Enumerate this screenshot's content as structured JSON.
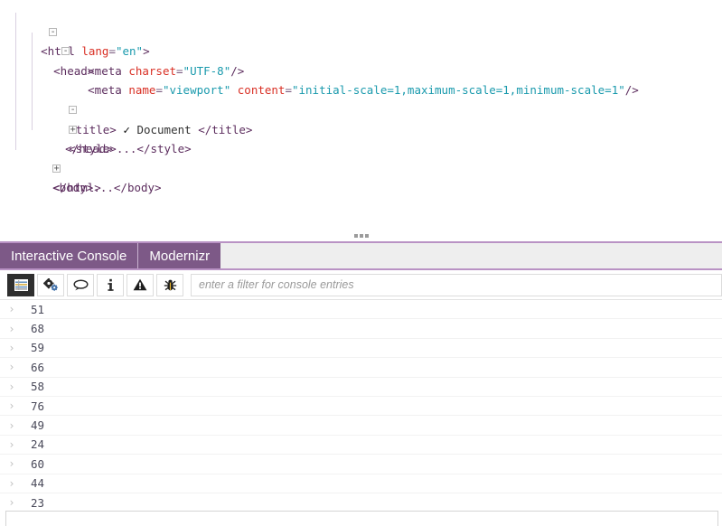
{
  "dom_inspector": {
    "lines": [
      {
        "toggle": "-",
        "indent": 0,
        "text": "<html lang=\"en\">"
      },
      {
        "toggle": "-",
        "indent": 1,
        "text": "<head>"
      },
      {
        "toggle": "",
        "indent": 2,
        "text": "<meta charset=\"UTF-8\"/>"
      },
      {
        "toggle": "",
        "indent": 2,
        "text": "<meta name=\"viewport\" content=\"initial-scale=1,maximum-scale=1,minimum-scale=1\"/>"
      },
      {
        "toggle": "-",
        "indent": 2,
        "text": "<title> ✓ Document </title>"
      },
      {
        "toggle": "+",
        "indent": 2,
        "text": "<style>...</style>"
      },
      {
        "toggle": "",
        "indent": 1,
        "text": "</head>"
      },
      {
        "toggle": "+",
        "indent": 1,
        "text": "<body>...</body>"
      },
      {
        "toggle": "",
        "indent": 0,
        "text": "</html>"
      }
    ],
    "tokens": {
      "html_tag_open": "<html",
      "html_attr": "lang",
      "html_attr_value": "\"en\"",
      "head_tag": "<head>",
      "meta_tag": "<meta",
      "charset_attr": "charset",
      "charset_value": "\"UTF-8\"",
      "self_close": "/>",
      "name_attr": "name",
      "name_value": "\"viewport\"",
      "content_attr": "content",
      "content_value": "\"initial-scale=1,maximum-scale=1,minimum-scale=1\"",
      "title_open": "<title>",
      "title_check": "✓",
      "title_text": "Document",
      "title_close": "</title>",
      "style_open": "<style>",
      "style_ellipsis": "...",
      "style_close": "</style>",
      "head_close": "</head>",
      "body_open": "<body>",
      "body_ellipsis": "...",
      "body_close": "</body>",
      "html_close": "</html>"
    }
  },
  "splitter": {
    "handle_dots": 3
  },
  "console": {
    "tabs": [
      {
        "label": "Interactive Console",
        "active": true
      },
      {
        "label": "Modernizr",
        "active": true
      }
    ],
    "toolbar": {
      "buttons": [
        {
          "name": "log-entries-toggle",
          "icon": "list-icon",
          "glyph": "▤",
          "active": true
        },
        {
          "name": "css-entries-toggle",
          "icon": "gears-icon",
          "glyph": "⚙",
          "active": false
        },
        {
          "name": "messages-toggle",
          "icon": "speech-bubble-icon",
          "glyph": "🗨",
          "active": false
        },
        {
          "name": "info-entries-toggle",
          "icon": "info-icon",
          "glyph": "i",
          "active": false
        },
        {
          "name": "warning-entries-toggle",
          "icon": "warning-icon",
          "glyph": "⚠",
          "active": false
        },
        {
          "name": "error-entries-toggle",
          "icon": "bug-icon",
          "glyph": "🐞",
          "active": false
        }
      ],
      "filter_placeholder": "enter a filter for console entries",
      "filter_value": ""
    },
    "entries": [
      {
        "arrow": "›",
        "value": "51"
      },
      {
        "arrow": "›",
        "value": "68"
      },
      {
        "arrow": "›",
        "value": "59"
      },
      {
        "arrow": "›",
        "value": "66"
      },
      {
        "arrow": "›",
        "value": "58"
      },
      {
        "arrow": "›",
        "value": "76"
      },
      {
        "arrow": "›",
        "value": "49"
      },
      {
        "arrow": "›",
        "value": "24"
      },
      {
        "arrow": "›",
        "value": "60"
      },
      {
        "arrow": "›",
        "value": "44"
      },
      {
        "arrow": "›",
        "value": "23"
      }
    ],
    "command_input": {
      "value": "",
      "placeholder": ""
    }
  },
  "colors": {
    "tab_active_bg": "#7d5987",
    "tabbar_border": "#b992c4",
    "tabbar_bg": "#eeeeee",
    "toolbar_active_btn": "#2e2e2e",
    "tag": "#5c2d5e",
    "attribute": "#d93025",
    "attribute_value": "#1a9aad"
  }
}
